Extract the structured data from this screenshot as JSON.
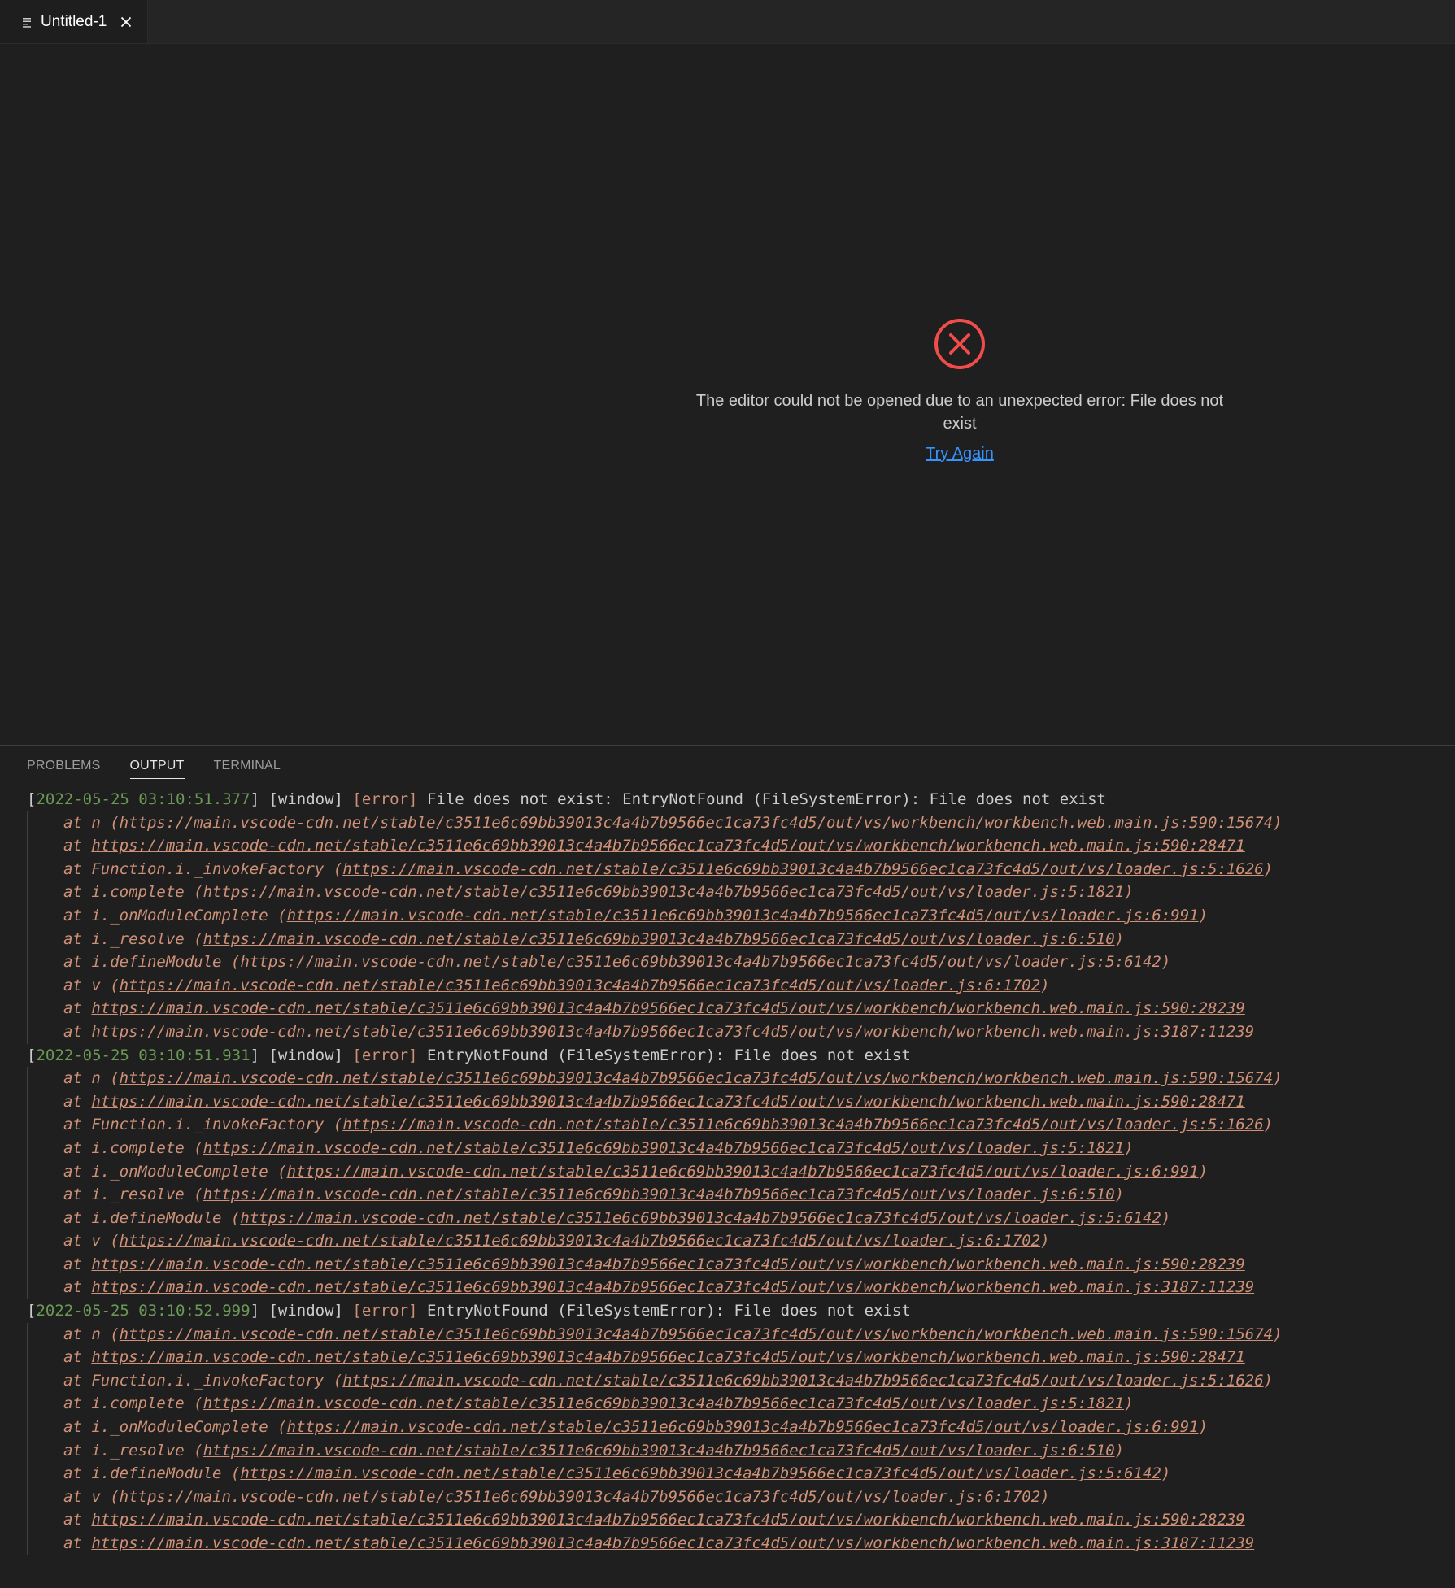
{
  "tab": {
    "label": "Untitled-1",
    "icon": "text-file-icon",
    "close_icon": "close-icon"
  },
  "editor": {
    "error_message": "The editor could not be opened due to an unexpected error: File does not exist",
    "try_again": "Try Again",
    "icon": "error-circle-icon",
    "error_color": "#f14c4c"
  },
  "panel": {
    "tabs": [
      {
        "label": "PROBLEMS",
        "active": false
      },
      {
        "label": "OUTPUT",
        "active": true
      },
      {
        "label": "TERMINAL",
        "active": false
      }
    ]
  },
  "log": {
    "entries": [
      {
        "timestamp": "2022-05-25 03:10:51.377",
        "source": "[window]",
        "level": "[error]",
        "message": "File does not exist: EntryNotFound (FileSystemError): File does not exist",
        "stack": [
          {
            "fn": "n",
            "url": "https://main.vscode-cdn.net/stable/c3511e6c69bb39013c4a4b7b9566ec1ca73fc4d5/out/vs/workbench/workbench.web.main.js:590:15674"
          },
          {
            "fn": "",
            "url": "https://main.vscode-cdn.net/stable/c3511e6c69bb39013c4a4b7b9566ec1ca73fc4d5/out/vs/workbench/workbench.web.main.js:590:28471"
          },
          {
            "fn": "Function.i._invokeFactory",
            "url": "https://main.vscode-cdn.net/stable/c3511e6c69bb39013c4a4b7b9566ec1ca73fc4d5/out/vs/loader.js:5:1626"
          },
          {
            "fn": "i.complete",
            "url": "https://main.vscode-cdn.net/stable/c3511e6c69bb39013c4a4b7b9566ec1ca73fc4d5/out/vs/loader.js:5:1821"
          },
          {
            "fn": "i._onModuleComplete",
            "url": "https://main.vscode-cdn.net/stable/c3511e6c69bb39013c4a4b7b9566ec1ca73fc4d5/out/vs/loader.js:6:991"
          },
          {
            "fn": "i._resolve",
            "url": "https://main.vscode-cdn.net/stable/c3511e6c69bb39013c4a4b7b9566ec1ca73fc4d5/out/vs/loader.js:6:510"
          },
          {
            "fn": "i.defineModule",
            "url": "https://main.vscode-cdn.net/stable/c3511e6c69bb39013c4a4b7b9566ec1ca73fc4d5/out/vs/loader.js:5:6142"
          },
          {
            "fn": "v",
            "url": "https://main.vscode-cdn.net/stable/c3511e6c69bb39013c4a4b7b9566ec1ca73fc4d5/out/vs/loader.js:6:1702"
          },
          {
            "fn": "",
            "url": "https://main.vscode-cdn.net/stable/c3511e6c69bb39013c4a4b7b9566ec1ca73fc4d5/out/vs/workbench/workbench.web.main.js:590:28239"
          },
          {
            "fn": "",
            "url": "https://main.vscode-cdn.net/stable/c3511e6c69bb39013c4a4b7b9566ec1ca73fc4d5/out/vs/workbench/workbench.web.main.js:3187:11239"
          }
        ]
      },
      {
        "timestamp": "2022-05-25 03:10:51.931",
        "source": "[window]",
        "level": "[error]",
        "message": "EntryNotFound (FileSystemError): File does not exist",
        "stack": [
          {
            "fn": "n",
            "url": "https://main.vscode-cdn.net/stable/c3511e6c69bb39013c4a4b7b9566ec1ca73fc4d5/out/vs/workbench/workbench.web.main.js:590:15674"
          },
          {
            "fn": "",
            "url": "https://main.vscode-cdn.net/stable/c3511e6c69bb39013c4a4b7b9566ec1ca73fc4d5/out/vs/workbench/workbench.web.main.js:590:28471"
          },
          {
            "fn": "Function.i._invokeFactory",
            "url": "https://main.vscode-cdn.net/stable/c3511e6c69bb39013c4a4b7b9566ec1ca73fc4d5/out/vs/loader.js:5:1626"
          },
          {
            "fn": "i.complete",
            "url": "https://main.vscode-cdn.net/stable/c3511e6c69bb39013c4a4b7b9566ec1ca73fc4d5/out/vs/loader.js:5:1821"
          },
          {
            "fn": "i._onModuleComplete",
            "url": "https://main.vscode-cdn.net/stable/c3511e6c69bb39013c4a4b7b9566ec1ca73fc4d5/out/vs/loader.js:6:991"
          },
          {
            "fn": "i._resolve",
            "url": "https://main.vscode-cdn.net/stable/c3511e6c69bb39013c4a4b7b9566ec1ca73fc4d5/out/vs/loader.js:6:510"
          },
          {
            "fn": "i.defineModule",
            "url": "https://main.vscode-cdn.net/stable/c3511e6c69bb39013c4a4b7b9566ec1ca73fc4d5/out/vs/loader.js:5:6142"
          },
          {
            "fn": "v",
            "url": "https://main.vscode-cdn.net/stable/c3511e6c69bb39013c4a4b7b9566ec1ca73fc4d5/out/vs/loader.js:6:1702"
          },
          {
            "fn": "",
            "url": "https://main.vscode-cdn.net/stable/c3511e6c69bb39013c4a4b7b9566ec1ca73fc4d5/out/vs/workbench/workbench.web.main.js:590:28239"
          },
          {
            "fn": "",
            "url": "https://main.vscode-cdn.net/stable/c3511e6c69bb39013c4a4b7b9566ec1ca73fc4d5/out/vs/workbench/workbench.web.main.js:3187:11239"
          }
        ]
      },
      {
        "timestamp": "2022-05-25 03:10:52.999",
        "source": "[window]",
        "level": "[error]",
        "message": "EntryNotFound (FileSystemError): File does not exist",
        "stack": [
          {
            "fn": "n",
            "url": "https://main.vscode-cdn.net/stable/c3511e6c69bb39013c4a4b7b9566ec1ca73fc4d5/out/vs/workbench/workbench.web.main.js:590:15674"
          },
          {
            "fn": "",
            "url": "https://main.vscode-cdn.net/stable/c3511e6c69bb39013c4a4b7b9566ec1ca73fc4d5/out/vs/workbench/workbench.web.main.js:590:28471"
          },
          {
            "fn": "Function.i._invokeFactory",
            "url": "https://main.vscode-cdn.net/stable/c3511e6c69bb39013c4a4b7b9566ec1ca73fc4d5/out/vs/loader.js:5:1626"
          },
          {
            "fn": "i.complete",
            "url": "https://main.vscode-cdn.net/stable/c3511e6c69bb39013c4a4b7b9566ec1ca73fc4d5/out/vs/loader.js:5:1821"
          },
          {
            "fn": "i._onModuleComplete",
            "url": "https://main.vscode-cdn.net/stable/c3511e6c69bb39013c4a4b7b9566ec1ca73fc4d5/out/vs/loader.js:6:991"
          },
          {
            "fn": "i._resolve",
            "url": "https://main.vscode-cdn.net/stable/c3511e6c69bb39013c4a4b7b9566ec1ca73fc4d5/out/vs/loader.js:6:510"
          },
          {
            "fn": "i.defineModule",
            "url": "https://main.vscode-cdn.net/stable/c3511e6c69bb39013c4a4b7b9566ec1ca73fc4d5/out/vs/loader.js:5:6142"
          },
          {
            "fn": "v",
            "url": "https://main.vscode-cdn.net/stable/c3511e6c69bb39013c4a4b7b9566ec1ca73fc4d5/out/vs/loader.js:6:1702"
          },
          {
            "fn": "",
            "url": "https://main.vscode-cdn.net/stable/c3511e6c69bb39013c4a4b7b9566ec1ca73fc4d5/out/vs/workbench/workbench.web.main.js:590:28239"
          },
          {
            "fn": "",
            "url": "https://main.vscode-cdn.net/stable/c3511e6c69bb39013c4a4b7b9566ec1ca73fc4d5/out/vs/workbench/workbench.web.main.js:3187:11239"
          }
        ]
      }
    ]
  }
}
